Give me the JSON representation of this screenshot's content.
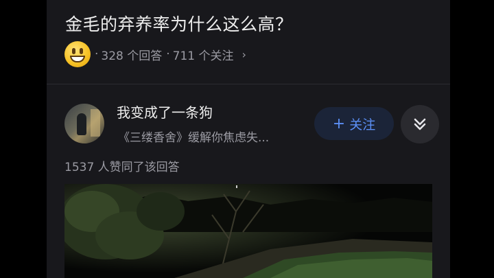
{
  "question": {
    "title": "金毛的弃养率为什么这么高？",
    "emoji_icon": "grinning-face-emoji",
    "meta_separator": "·",
    "answers_count": "328 个回答",
    "followers_count": "711 个关注",
    "chevron": "›"
  },
  "answer": {
    "author_name": "我变成了一条狗",
    "author_bio": "《三缕香舍》缓解你焦虑失...",
    "follow_plus": "+",
    "follow_label": "关注",
    "expand_icon": "double-chevron-down-icon",
    "votes_text": "1537 人赞同了该回答"
  },
  "colors": {
    "background": "#000000",
    "panel": "#18181c",
    "text_primary": "#eeeeee",
    "text_secondary": "#9b9ba3",
    "accent": "#5b8ff5",
    "follow_bg": "#1b2438"
  }
}
